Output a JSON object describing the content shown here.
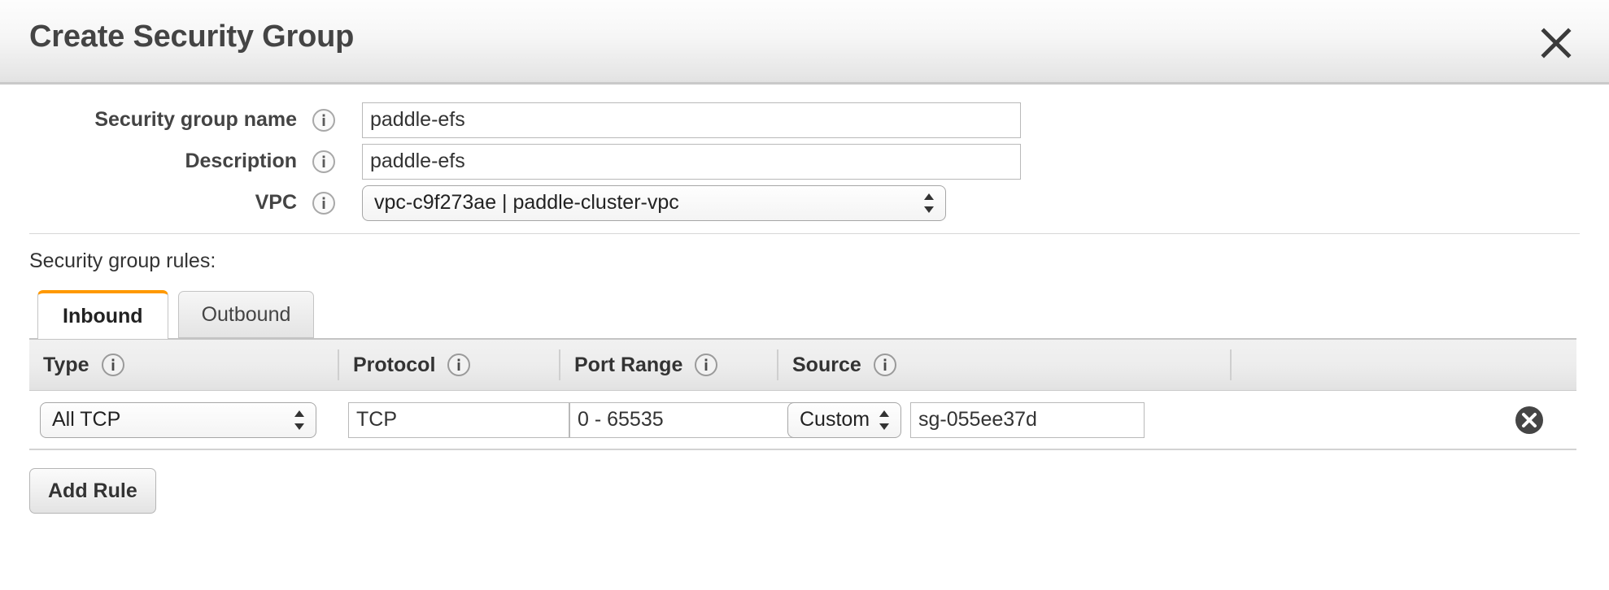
{
  "dialog": {
    "title": "Create Security Group",
    "close_label": "×"
  },
  "form": {
    "fields": [
      {
        "label": "Security group name",
        "value": "paddle-efs",
        "placeholder": "",
        "info": "info-icon"
      },
      {
        "label": "Description",
        "value": "paddle-efs",
        "placeholder": "",
        "info": "info-icon"
      },
      {
        "label": "VPC",
        "value": "vpc-c9f273ae | paddle-cluster-vpc",
        "info": "info-icon"
      }
    ]
  },
  "rules": {
    "heading": "Security group rules:",
    "tabs": [
      {
        "label": "Inbound",
        "active": true
      },
      {
        "label": "Outbound",
        "active": false
      }
    ],
    "columns": [
      {
        "label": "Type"
      },
      {
        "label": "Protocol"
      },
      {
        "label": "Port Range"
      },
      {
        "label": "Source"
      },
      {
        "label": ""
      }
    ],
    "rows": [
      {
        "type": "All TCP",
        "protocol": "TCP",
        "port_range": "0 - 65535",
        "source_kind": "Custom",
        "source_value": "sg-055ee37d"
      }
    ],
    "add_rule_label": "Add Rule"
  },
  "colors": {
    "accent_orange": "#ff9900",
    "header_gradient_top": "#fdfdfd",
    "header_gradient_bottom": "#e2e2e2",
    "text_dark": "#444444",
    "border_gray": "#c4c4c4"
  }
}
